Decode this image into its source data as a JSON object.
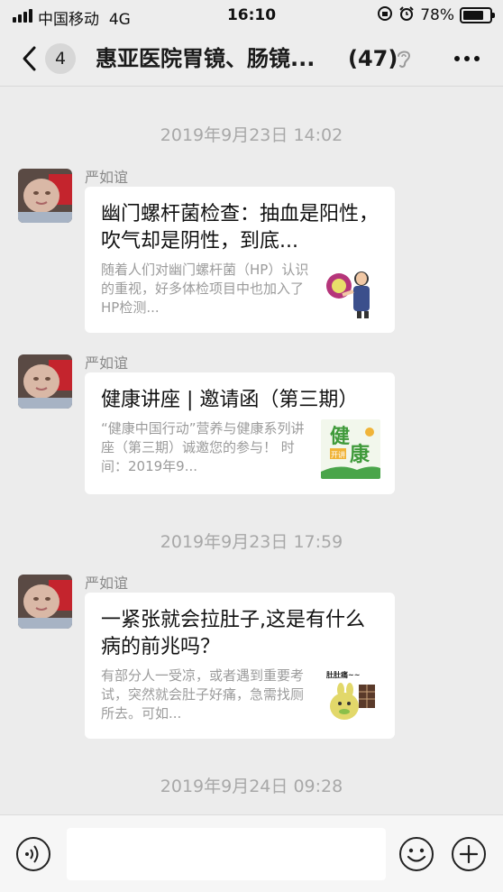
{
  "status_bar": {
    "carrier": "中国移动",
    "network": "4G",
    "time": "16:10",
    "battery": "78%",
    "battery_level": 0.78
  },
  "header": {
    "unread_count": "4",
    "title": "惠亚医院胃镜、肠镜...",
    "member_count": "(47)"
  },
  "messages": [
    {
      "timestamp": "2019年9月23日 14:02",
      "sender": "严如谊",
      "title": "幽门螺杆菌检查：抽血是阳性，吹气却是阴性，到底...",
      "description": "随着人们对幽门螺杆菌（HP）认识的重视，好多体检项目中也加入了HP检测..."
    },
    {
      "sender": "严如谊",
      "title": "健康讲座 | 邀请函（第三期）",
      "description": "“健康中国行动”营养与健康系列讲座（第三期）诚邀您的参与！ 时间：2019年9...",
      "thumb_text_1": "健",
      "thumb_text_2": "康",
      "thumb_tag": "开讲"
    },
    {
      "timestamp": "2019年9月23日 17:59",
      "sender": "严如谊",
      "title": "一紧张就会拉肚子,这是有什么病的前兆吗？",
      "description": "有部分人一受凉，或者遇到重要考试，突然就会肚子好痛，急需找厕所去。可如...",
      "thumb_text": "肚肚痛~~"
    }
  ],
  "last_timestamp": "2019年9月24日 09:28",
  "icons": {
    "back": "chevron-left-icon",
    "mute": "ear-muted-icon",
    "more": "ellipsis-icon",
    "voice": "voice-icon",
    "emoji": "smiley-icon",
    "plus": "plus-icon"
  }
}
